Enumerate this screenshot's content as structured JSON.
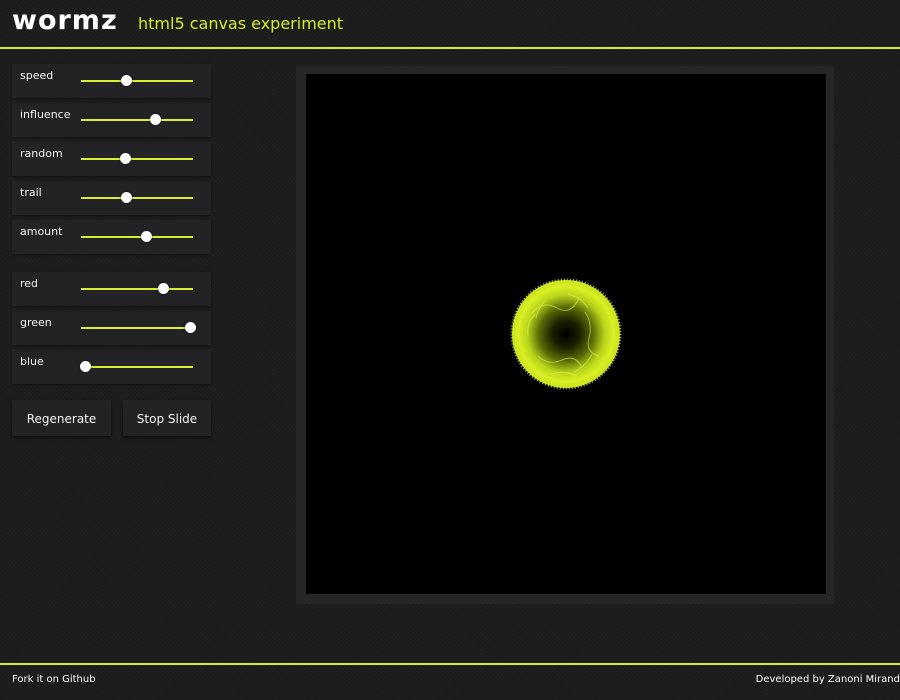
{
  "header": {
    "logo": "wormz",
    "subtitle": "html5 canvas experiment"
  },
  "controls": {
    "speed": {
      "label": "speed",
      "value": 0.4
    },
    "influence": {
      "label": "influence",
      "value": 0.66
    },
    "random": {
      "label": "random",
      "value": 0.39
    },
    "trail": {
      "label": "trail",
      "value": 0.4
    },
    "amount": {
      "label": "amount",
      "value": 0.58
    },
    "red": {
      "label": "red",
      "value": 0.73
    },
    "green": {
      "label": "green",
      "value": 0.97
    },
    "blue": {
      "label": "blue",
      "value": 0.04
    }
  },
  "buttons": {
    "regenerate": "Regenerate",
    "stop_slide": "Stop Slide"
  },
  "footer": {
    "fork": "Fork it on Github",
    "credit": "Developed by Zanoni Mirand"
  },
  "colors": {
    "accent": "#d6ee2e",
    "canvas_bg": "#000000",
    "panel_bg": "#232325"
  }
}
